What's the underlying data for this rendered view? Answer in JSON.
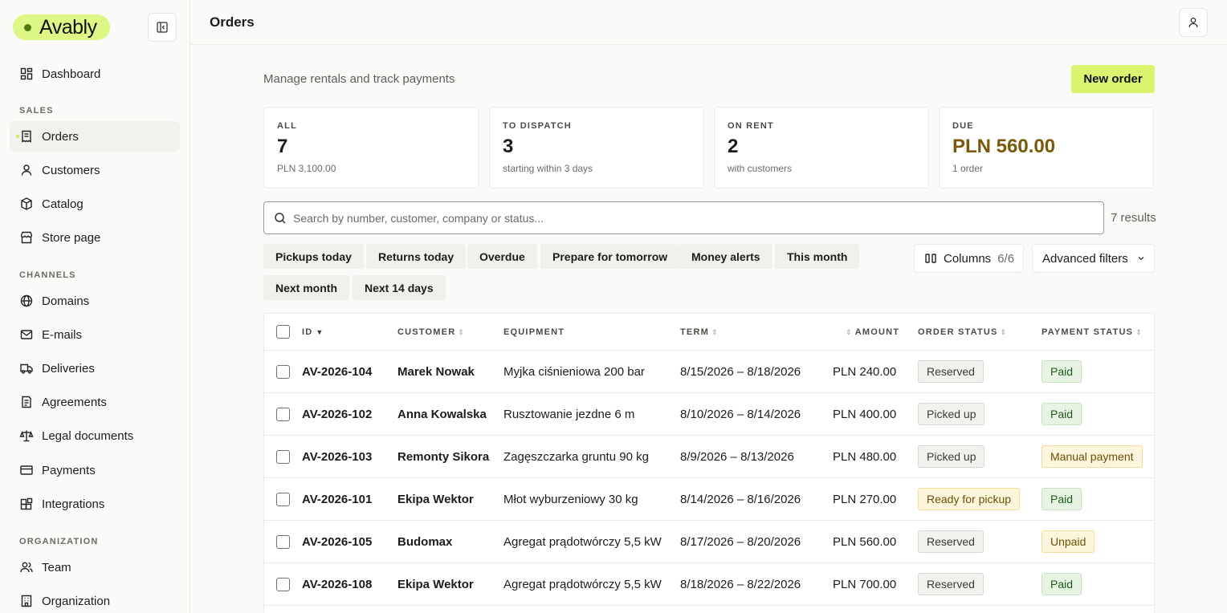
{
  "app": {
    "logo": "Avably"
  },
  "sidebar": {
    "dashboard": "Dashboard",
    "sections": {
      "sales": "SALES",
      "channels": "CHANNELS",
      "organization": "ORGANIZATION"
    },
    "sales": [
      "Orders",
      "Customers",
      "Catalog",
      "Store page"
    ],
    "channels": [
      "Domains",
      "E-mails",
      "Deliveries",
      "Agreements",
      "Legal documents",
      "Payments",
      "Integrations"
    ],
    "organization": [
      "Team",
      "Organization"
    ]
  },
  "header": {
    "title": "Orders"
  },
  "main": {
    "subtitle": "Manage rentals and track payments",
    "new_order": "New order",
    "stats": [
      {
        "label": "ALL",
        "value": "7",
        "sub": "PLN 3,100.00"
      },
      {
        "label": "TO DISPATCH",
        "value": "3",
        "sub": "starting within 3 days"
      },
      {
        "label": "ON RENT",
        "value": "2",
        "sub": "with customers"
      },
      {
        "label": "DUE",
        "value": "PLN 560.00",
        "sub": "1 order"
      }
    ],
    "search_placeholder": "Search by number, customer, company or status...",
    "results": "7 results",
    "chips": [
      "Pickups today",
      "Returns today",
      "Overdue",
      "Prepare for tomorrow",
      "Money alerts",
      "This month",
      "Next month",
      "Next 14 days"
    ],
    "columns_label": "Columns",
    "columns_count": "6/6",
    "advanced_filters": "Advanced filters"
  },
  "table": {
    "headers": {
      "id": "ID",
      "customer": "CUSTOMER",
      "equipment": "EQUIPMENT",
      "term": "TERM",
      "amount": "AMOUNT",
      "order_status": "ORDER STATUS",
      "payment_status": "PAYMENT STATUS"
    },
    "rows": [
      {
        "id": "AV-2026-104",
        "customer": "Marek Nowak",
        "equipment": "Myjka ciśnieniowa 200 bar",
        "term": "8/15/2026 – 8/18/2026",
        "amount": "PLN 240.00",
        "order_status": "Reserved",
        "payment_status": "Paid"
      },
      {
        "id": "AV-2026-102",
        "customer": "Anna Kowalska",
        "equipment": "Rusztowanie jezdne 6 m",
        "term": "8/10/2026 – 8/14/2026",
        "amount": "PLN 400.00",
        "order_status": "Picked up",
        "payment_status": "Paid"
      },
      {
        "id": "AV-2026-103",
        "customer": "Remonty Sikora",
        "equipment": "Zagęszczarka gruntu 90 kg",
        "term": "8/9/2026 – 8/13/2026",
        "amount": "PLN 480.00",
        "order_status": "Picked up",
        "payment_status": "Manual payment"
      },
      {
        "id": "AV-2026-101",
        "customer": "Ekipa Wektor",
        "equipment": "Młot wyburzeniowy 30 kg",
        "term": "8/14/2026 – 8/16/2026",
        "amount": "PLN 270.00",
        "order_status": "Ready for pickup",
        "payment_status": "Paid"
      },
      {
        "id": "AV-2026-105",
        "customer": "Budomax",
        "equipment": "Agregat prądotwórczy 5,5 kW",
        "term": "8/17/2026 – 8/20/2026",
        "amount": "PLN 560.00",
        "order_status": "Reserved",
        "payment_status": "Unpaid"
      },
      {
        "id": "AV-2026-108",
        "customer": "Ekipa Wektor",
        "equipment": "Agregat prądotwórczy 5,5 kW",
        "term": "8/18/2026 – 8/22/2026",
        "amount": "PLN 700.00",
        "order_status": "Reserved",
        "payment_status": "Paid"
      }
    ]
  }
}
